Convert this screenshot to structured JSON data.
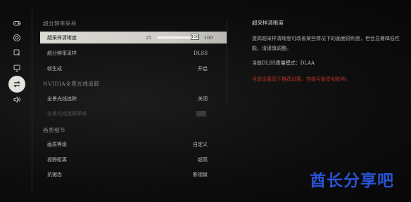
{
  "sidebar": {
    "items": [
      {
        "icon": "gamepad-icon",
        "active": false
      },
      {
        "icon": "settings-icon",
        "active": false
      },
      {
        "icon": "display-icon",
        "active": false
      },
      {
        "icon": "monitor-icon",
        "active": false
      },
      {
        "icon": "swap-arrows-icon",
        "active": true
      },
      {
        "icon": "speaker-icon",
        "active": false
      }
    ]
  },
  "sections": {
    "supersampling": "超分辨率采样",
    "nvidia": "NVIDIA全景光线追踪",
    "detail": "画质细节"
  },
  "settings": {
    "sharpness": {
      "label": "超采样清晰度",
      "min": "25",
      "value": "100",
      "max": "100",
      "level": 1.0
    },
    "supersampling": {
      "label": "超分辨率采样",
      "value": "DLSS"
    },
    "frame_gen": {
      "label": "帧生成",
      "value": "开启"
    },
    "pt": {
      "label": "全景光线追踪",
      "value": "关闭"
    },
    "pt_sub": {
      "label": "全景光线追踪降噪"
    },
    "quality": {
      "label": "画质等级",
      "value": "自定义"
    },
    "view_distance": {
      "label": "视野距离",
      "value": "超高"
    },
    "aa": {
      "label": "抗锯齿",
      "value": "影视级"
    }
  },
  "info": {
    "title": "超采样清晰度",
    "description": "提高超采样清晰度可改善某些情况下的画面锐利度，但会显著降低性能，请谨慎调整。",
    "mode": "当前DLSS质量模式：DLAA",
    "warning": "当前设置高于推荐设置，性能可能受到影响。"
  },
  "watermark": "酋长分享吧",
  "colors": {
    "warning": "#b8332a",
    "watermark": "#2a52d6"
  }
}
